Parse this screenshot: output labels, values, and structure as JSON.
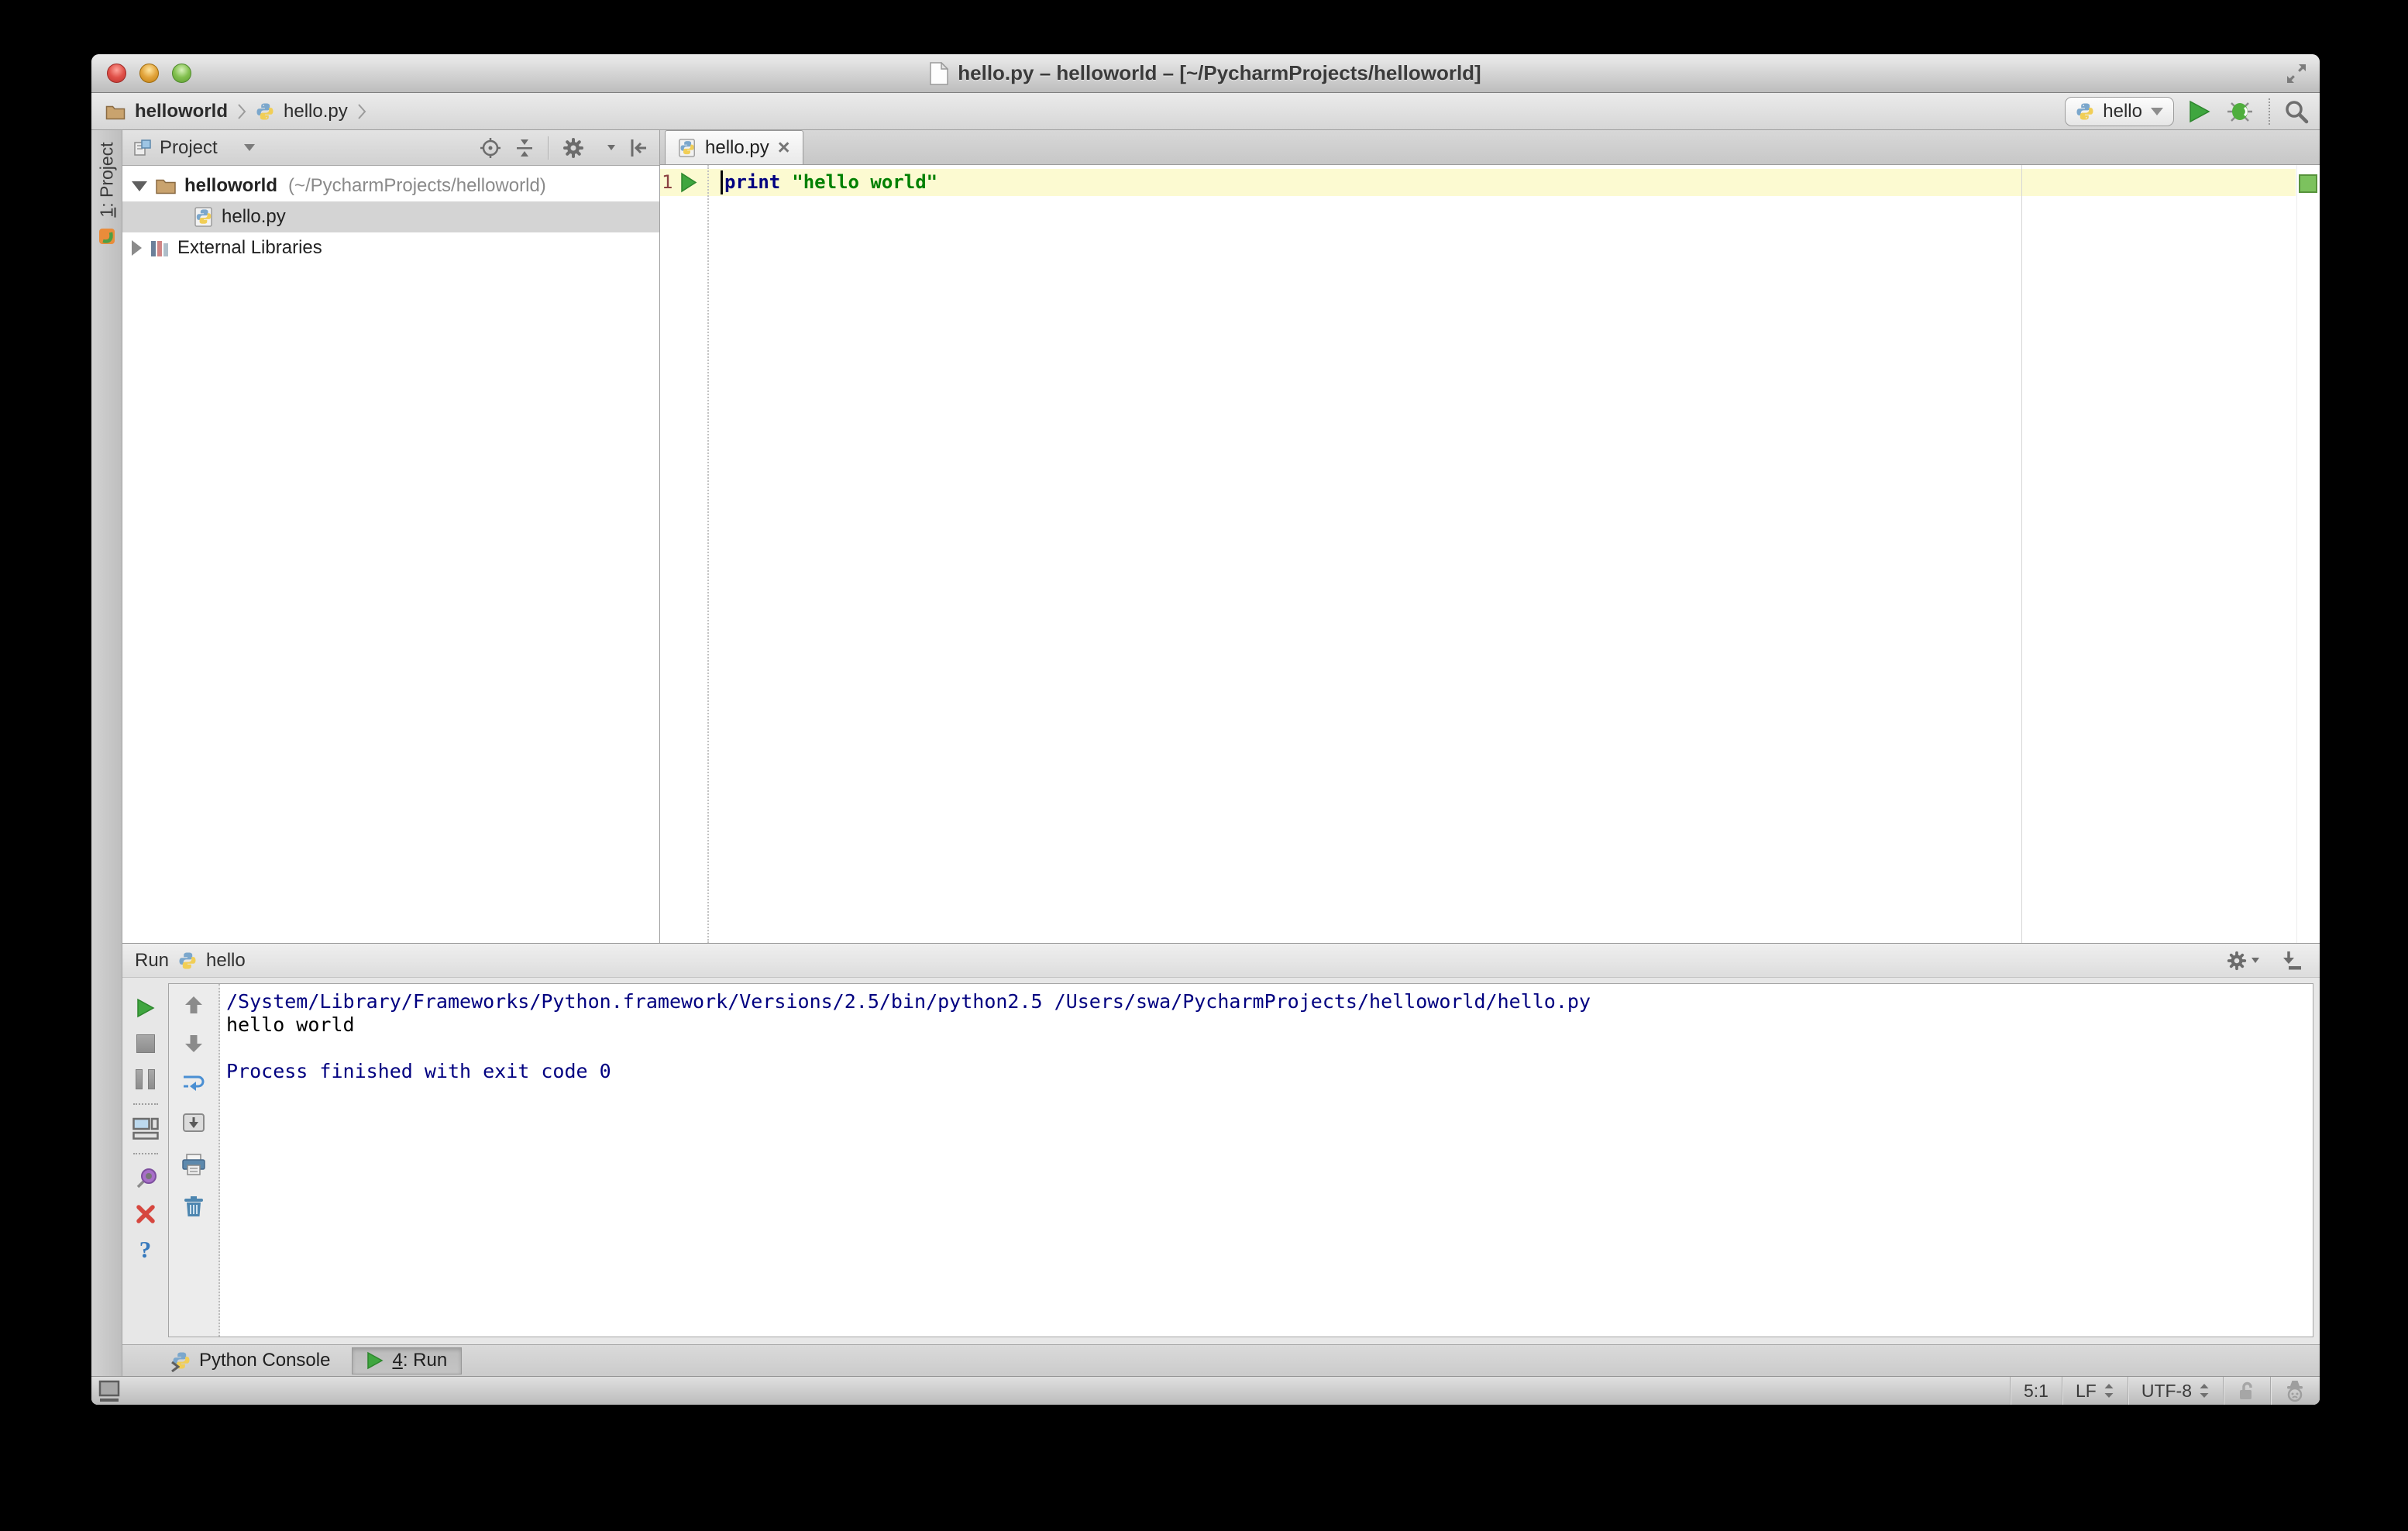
{
  "colors": {
    "keyword": "#000080",
    "string": "#008000",
    "console_info": "#000080",
    "current_line_highlight": "#fcfad1",
    "run_green": "#3fa63f",
    "tree_selection": "#d4d4d4",
    "inspection_ok_green": "#7cc25e"
  },
  "window": {
    "title": "hello.py – helloworld – [~/PycharmProjects/helloworld]"
  },
  "navbar": {
    "breadcrumbs": {
      "project": "helloworld",
      "file": "hello.py"
    },
    "run_config": {
      "label": "hello"
    }
  },
  "tool_stripe": {
    "project_tab": {
      "mnemonic": "1",
      "rest": ": Project"
    }
  },
  "project_panel": {
    "title": "Project",
    "tree": {
      "root_name": "helloworld",
      "root_path": "(~/PycharmProjects/helloworld)",
      "file_name": "hello.py",
      "libraries": "External Libraries"
    }
  },
  "editor": {
    "tab_label": "hello.py",
    "close_glyph": "×",
    "line_number": "1",
    "code": {
      "keyword": "print",
      "string": "\"hello world\""
    }
  },
  "run_panel": {
    "title": "Run",
    "config_label": "hello",
    "console_lines": [
      "/System/Library/Frameworks/Python.framework/Versions/2.5/bin/python2.5 /Users/swa/PycharmProjects/helloworld/hello.py",
      "hello world",
      "",
      "Process finished with exit code 0"
    ]
  },
  "bottom_bar": {
    "console_tab": "Python Console",
    "run_tab": {
      "mnemonic": "4",
      "rest": ": Run"
    }
  },
  "status_bar": {
    "caret_position": "5:1",
    "line_separator": "LF",
    "encoding": "UTF-8"
  },
  "icons": {
    "run": "green-play-triangle",
    "debug": "green-bug",
    "search": "magnifier",
    "settings": "gear",
    "close": "red-x",
    "help": "question-mark",
    "pin": "purple-pin",
    "print": "printer",
    "clear": "trash-can",
    "lock": "open-padlock",
    "hector": "inspector-face"
  }
}
